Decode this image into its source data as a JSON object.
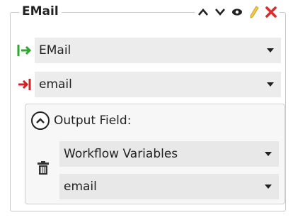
{
  "panel": {
    "title": "EMail",
    "actions": [
      {
        "name": "move-up-icon"
      },
      {
        "name": "move-down-icon"
      },
      {
        "name": "eye-icon"
      },
      {
        "name": "pencil-icon"
      },
      {
        "name": "close-icon"
      }
    ]
  },
  "input_row": {
    "icon": "input-arrow-icon",
    "value": "EMail",
    "icon_color": "#2ea82e"
  },
  "output_row": {
    "icon": "output-arrow-icon",
    "value": "email",
    "icon_color": "#d32020"
  },
  "output_field": {
    "label": "Output Field:",
    "scope_value": "Workflow Variables",
    "variable_value": "email"
  },
  "colors": {
    "close": "#e02a2a",
    "pencil": "#f2c94c"
  }
}
